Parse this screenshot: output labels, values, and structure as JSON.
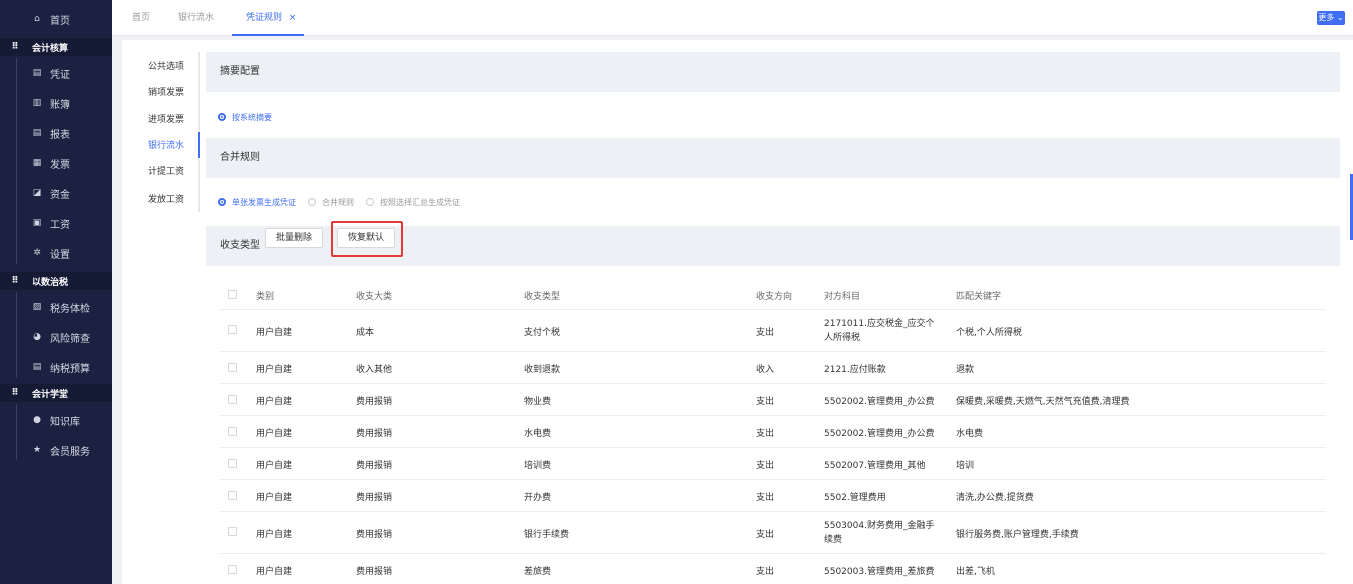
{
  "sidebar": {
    "home": "首页",
    "groups": [
      {
        "label": "会计核算",
        "items": [
          {
            "icon": "document-icon",
            "label": "凭证"
          },
          {
            "icon": "ledger-icon",
            "label": "账簿"
          },
          {
            "icon": "report-icon",
            "label": "报表"
          },
          {
            "icon": "invoice-icon",
            "label": "发票"
          },
          {
            "icon": "funds-icon",
            "label": "资金"
          },
          {
            "icon": "salary-icon",
            "label": "工资"
          },
          {
            "icon": "gear-icon",
            "label": "设置"
          }
        ]
      },
      {
        "label": "以数治税",
        "items": [
          {
            "icon": "checkup-icon",
            "label": "税务体检"
          },
          {
            "icon": "risk-icon",
            "label": "风险筛查"
          },
          {
            "icon": "budget-icon",
            "label": "纳税预算"
          }
        ]
      },
      {
        "label": "会计学堂",
        "items": [
          {
            "icon": "location-icon",
            "label": "知识库"
          },
          {
            "icon": "star-icon",
            "label": "会员服务"
          }
        ]
      }
    ]
  },
  "tabs": [
    {
      "label": "首页",
      "active": false
    },
    {
      "label": "银行流水",
      "active": false
    },
    {
      "label": "凭证规则",
      "active": true,
      "close": "×"
    }
  ],
  "more_button": "更多 ⌄",
  "subnav": [
    "公共选项",
    "销项发票",
    "进项发票",
    "银行流水",
    "计提工资",
    "发放工资"
  ],
  "subnav_active": "银行流水",
  "summary_section": {
    "title": "摘要配置",
    "options": [
      {
        "label": "按系统摘要",
        "selected": true
      }
    ]
  },
  "merge_section": {
    "title": "合并规则",
    "options": [
      {
        "label": "单张发票生成凭证",
        "selected": true
      },
      {
        "label": "合并规则",
        "selected": false
      },
      {
        "label": "按照选择汇总生成凭证",
        "selected": false
      }
    ]
  },
  "type_section": {
    "title": "收支类型",
    "batch_delete": "批量删除",
    "restore_default": "恢复默认"
  },
  "table": {
    "headers": [
      "类别",
      "收支大类",
      "收支类型",
      "收支方向",
      "对方科目",
      "匹配关键字"
    ],
    "rows": [
      [
        "用户自建",
        "成本",
        "支付个税",
        "支出",
        "2171011.应交税金_应交个人所得税",
        "个税,个人所得税"
      ],
      [
        "用户自建",
        "收入其他",
        "收到退款",
        "收入",
        "2121.应付账款",
        "退款"
      ],
      [
        "用户自建",
        "费用报销",
        "物业费",
        "支出",
        "5502002.管理费用_办公费",
        "保暖费,采暖费,天燃气,天然气充值费,清理费"
      ],
      [
        "用户自建",
        "费用报销",
        "水电费",
        "支出",
        "5502002.管理费用_办公费",
        "水电费"
      ],
      [
        "用户自建",
        "费用报销",
        "培训费",
        "支出",
        "5502007.管理费用_其他",
        "培训"
      ],
      [
        "用户自建",
        "费用报销",
        "开办费",
        "支出",
        "5502.管理费用",
        "清洗,办公费,提货费"
      ],
      [
        "用户自建",
        "费用报销",
        "银行手续费",
        "支出",
        "5503004.财务费用_金融手续费",
        "银行服务费,账户管理费,手续费"
      ],
      [
        "用户自建",
        "费用报销",
        "差旅费",
        "支出",
        "5502003.管理费用_差旅费",
        "出差,飞机"
      ]
    ]
  }
}
